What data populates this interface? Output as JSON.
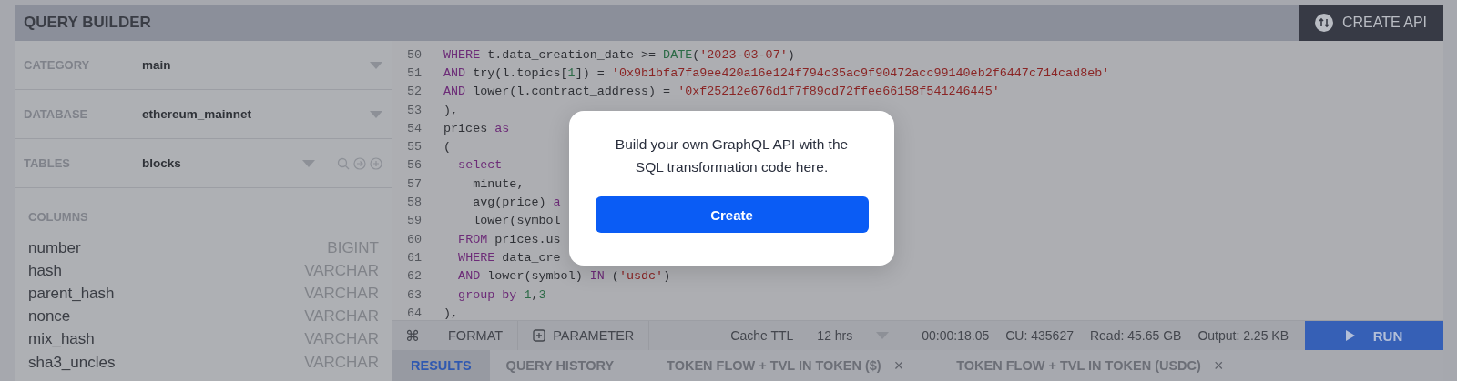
{
  "header": {
    "title": "QUERY BUILDER",
    "action": "CREATE API"
  },
  "selectors": [
    {
      "label": "CATEGORY",
      "value": "main",
      "tools": false
    },
    {
      "label": "DATABASE",
      "value": "ethereum_mainnet",
      "tools": false
    },
    {
      "label": "TABLES",
      "value": "blocks",
      "tools": true
    }
  ],
  "columns": {
    "title": "COLUMNS",
    "rows": [
      {
        "name": "number",
        "type": "BIGINT"
      },
      {
        "name": "hash",
        "type": "VARCHAR"
      },
      {
        "name": "parent_hash",
        "type": "VARCHAR"
      },
      {
        "name": "nonce",
        "type": "VARCHAR"
      },
      {
        "name": "mix_hash",
        "type": "VARCHAR"
      },
      {
        "name": "sha3_uncles",
        "type": "VARCHAR"
      }
    ]
  },
  "code": [
    {
      "number": "50",
      "tokens": [
        {
          "kind": "kw",
          "text": "WHERE"
        },
        {
          "kind": "plain",
          "text": " t.data_creation_date >= "
        },
        {
          "kind": "fn",
          "text": "DATE"
        },
        {
          "kind": "plain",
          "text": "("
        },
        {
          "kind": "str",
          "text": "'2023-03-07'"
        },
        {
          "kind": "plain",
          "text": ")"
        }
      ]
    },
    {
      "number": "51",
      "tokens": [
        {
          "kind": "kw",
          "text": "AND"
        },
        {
          "kind": "plain",
          "text": " try(l.topics["
        },
        {
          "kind": "num",
          "text": "1"
        },
        {
          "kind": "plain",
          "text": "]) = "
        },
        {
          "kind": "str",
          "text": "'0x9b1bfa7fa9ee420a16e124f794c35ac9f90472acc99140eb2f6447c714cad8eb'"
        }
      ]
    },
    {
      "number": "52",
      "tokens": [
        {
          "kind": "kw",
          "text": "AND"
        },
        {
          "kind": "plain",
          "text": " lower(l.contract_address) = "
        },
        {
          "kind": "str",
          "text": "'0xf25212e676d1f7f89cd72ffee66158f541246445'"
        }
      ]
    },
    {
      "number": "53",
      "tokens": [
        {
          "kind": "plain",
          "text": "),"
        }
      ]
    },
    {
      "number": "54",
      "tokens": [
        {
          "kind": "plain",
          "text": "prices "
        },
        {
          "kind": "kw",
          "text": "as"
        }
      ]
    },
    {
      "number": "55",
      "tokens": [
        {
          "kind": "plain",
          "text": "("
        }
      ],
      "children": [
        {
          "number": "56",
          "tokens": [
            {
              "kind": "kw",
              "text": "select"
            }
          ],
          "children": [
            {
              "number": "57",
              "tokens": [
                {
                  "kind": "plain",
                  "text": "minute,"
                }
              ]
            },
            {
              "number": "58",
              "tokens": [
                {
                  "kind": "plain",
                  "text": "avg(price) "
                },
                {
                  "kind": "kw",
                  "text": "a"
                }
              ]
            },
            {
              "number": "59",
              "tokens": [
                {
                  "kind": "plain",
                  "text": "lower(symbol"
                }
              ]
            }
          ]
        },
        {
          "number": "60",
          "tokens": [
            {
              "kind": "kw",
              "text": "FROM"
            },
            {
              "kind": "plain",
              "text": " prices.us"
            }
          ]
        },
        {
          "number": "61",
          "tokens": [
            {
              "kind": "kw",
              "text": "WHERE"
            },
            {
              "kind": "plain",
              "text": " data_cre"
            }
          ]
        },
        {
          "number": "62",
          "tokens": [
            {
              "kind": "kw",
              "text": "AND"
            },
            {
              "kind": "plain",
              "text": " lower(symbol) "
            },
            {
              "kind": "kw",
              "text": "IN"
            },
            {
              "kind": "plain",
              "text": " ("
            },
            {
              "kind": "str",
              "text": "'usdc'"
            },
            {
              "kind": "plain",
              "text": ")"
            }
          ]
        },
        {
          "number": "63",
          "tokens": [
            {
              "kind": "kw",
              "text": "group by "
            },
            {
              "kind": "num",
              "text": "1"
            },
            {
              "kind": "plain",
              "text": ","
            },
            {
              "kind": "num",
              "text": "3"
            }
          ]
        }
      ]
    },
    {
      "number": "64",
      "tokens": [
        {
          "kind": "plain",
          "text": "),"
        }
      ]
    }
  ],
  "toolbar": {
    "shortcut": "⌘",
    "format": "FORMAT",
    "parameter": "PARAMETER",
    "cache_label": "Cache TTL",
    "cache_value": "12 hrs",
    "stats": [
      "00:00:18.05",
      "CU: 435627",
      "Read: 45.65 GB",
      "Output: 2.25 KB"
    ],
    "run": "RUN"
  },
  "tabs": [
    {
      "label": "RESULTS",
      "selected": true,
      "closable": false
    },
    {
      "label": "QUERY HISTORY",
      "selected": false,
      "closable": false
    },
    {
      "label": "TOKEN FLOW + TVL IN TOKEN ($)",
      "selected": false,
      "closable": true,
      "close": "×"
    },
    {
      "label": "TOKEN FLOW + TVL IN TOKEN (USDC)",
      "selected": false,
      "closable": true,
      "close": "×"
    }
  ],
  "modal": {
    "message": "Build your own GraphQL API with the SQL transformation code here.",
    "button": "Create"
  }
}
